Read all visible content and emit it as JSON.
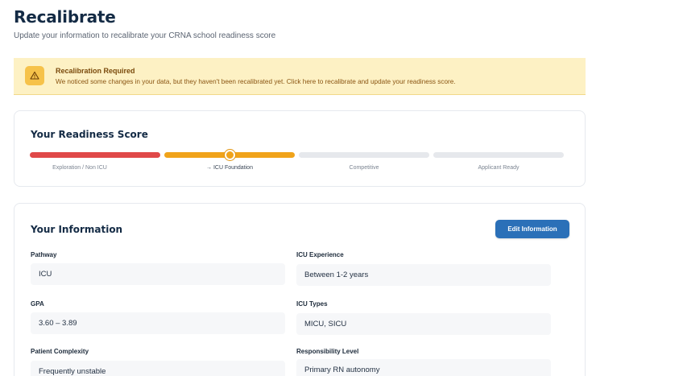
{
  "page": {
    "title": "Recalibrate",
    "subtitle": "Update your information to recalibrate your CRNA school readiness score"
  },
  "alert": {
    "icon": "warning-icon",
    "title": "Recalibration Required",
    "message": "We noticed some changes in your data, but they haven't been recalibrated yet. Click here to recalibrate and update your readiness score."
  },
  "readiness": {
    "title": "Your Readiness Score",
    "current_stage": "ICU Foundation",
    "segments": [
      {
        "label": "Exploration / Non ICU",
        "color": "#e04848",
        "filled": true
      },
      {
        "label": "→ ICU Foundation",
        "color": "#f0a31a",
        "filled": true
      },
      {
        "label": "Competitive",
        "color": "#e6e8ec",
        "filled": false
      },
      {
        "label": "Applicant Ready",
        "color": "#e6e8ec",
        "filled": false
      }
    ]
  },
  "info": {
    "title": "Your Information",
    "edit_label": "Edit Information",
    "fields": {
      "pathway": {
        "label": "Pathway",
        "value": "ICU"
      },
      "icu_experience": {
        "label": "ICU Experience",
        "value": "Between 1-2 years"
      },
      "gpa": {
        "label": "GPA",
        "value": "3.60 – 3.89"
      },
      "icu_types": {
        "label": "ICU Types",
        "value": "MICU, SICU"
      },
      "patient_complexity": {
        "label": "Patient Complexity",
        "value": "Frequently unstable"
      },
      "responsibility_level": {
        "label": "Responsibility Level",
        "value": "Primary RN autonomy"
      }
    }
  }
}
